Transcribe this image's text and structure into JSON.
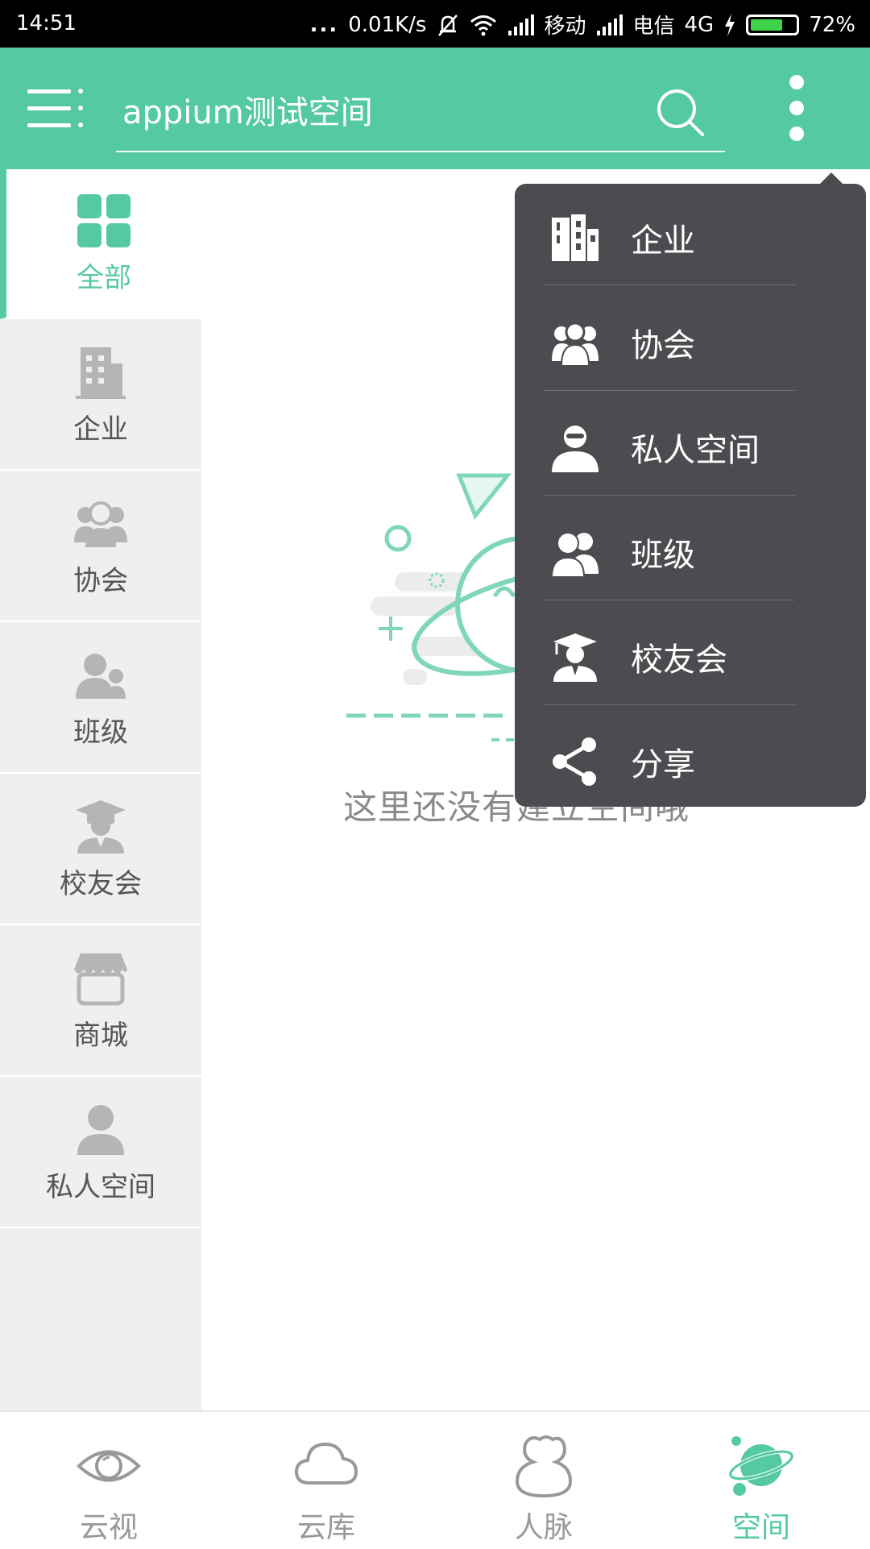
{
  "status_bar": {
    "time": "14:51",
    "dots": "...",
    "speed": "0.01K/s",
    "carrier1": "移动",
    "carrier2": "电信",
    "network": "4G",
    "battery": "72%",
    "battery_level": 0.72
  },
  "header": {
    "search_value": "appium测试空间"
  },
  "sidebar": {
    "items": [
      {
        "label": "全部",
        "icon": "grid-icon"
      },
      {
        "label": "企业",
        "icon": "building-icon"
      },
      {
        "label": "协会",
        "icon": "association-icon"
      },
      {
        "label": "班级",
        "icon": "class-icon"
      },
      {
        "label": "校友会",
        "icon": "graduate-icon"
      },
      {
        "label": "商城",
        "icon": "store-icon"
      },
      {
        "label": "私人空间",
        "icon": "person-icon"
      }
    ],
    "active_index": 0
  },
  "empty_state": {
    "message": "这里还没有建立空间哦"
  },
  "popup_menu": {
    "items": [
      {
        "label": "企业",
        "icon": "building-icon"
      },
      {
        "label": "协会",
        "icon": "association-icon"
      },
      {
        "label": "私人空间",
        "icon": "person-icon"
      },
      {
        "label": "班级",
        "icon": "class-icon"
      },
      {
        "label": "校友会",
        "icon": "graduate-icon"
      },
      {
        "label": "分享",
        "icon": "share-icon"
      }
    ]
  },
  "bottom_tabs": {
    "items": [
      {
        "label": "云视",
        "icon": "eye-icon"
      },
      {
        "label": "云库",
        "icon": "cloud-icon"
      },
      {
        "label": "人脉",
        "icon": "contacts-icon"
      },
      {
        "label": "空间",
        "icon": "planet-icon"
      }
    ],
    "active_index": 3
  },
  "colors": {
    "accent": "#55c9a4",
    "popup_bg": "#4c4c50",
    "sidebar_bg": "#efefef",
    "inactive_icon": "#b5b5b5"
  }
}
